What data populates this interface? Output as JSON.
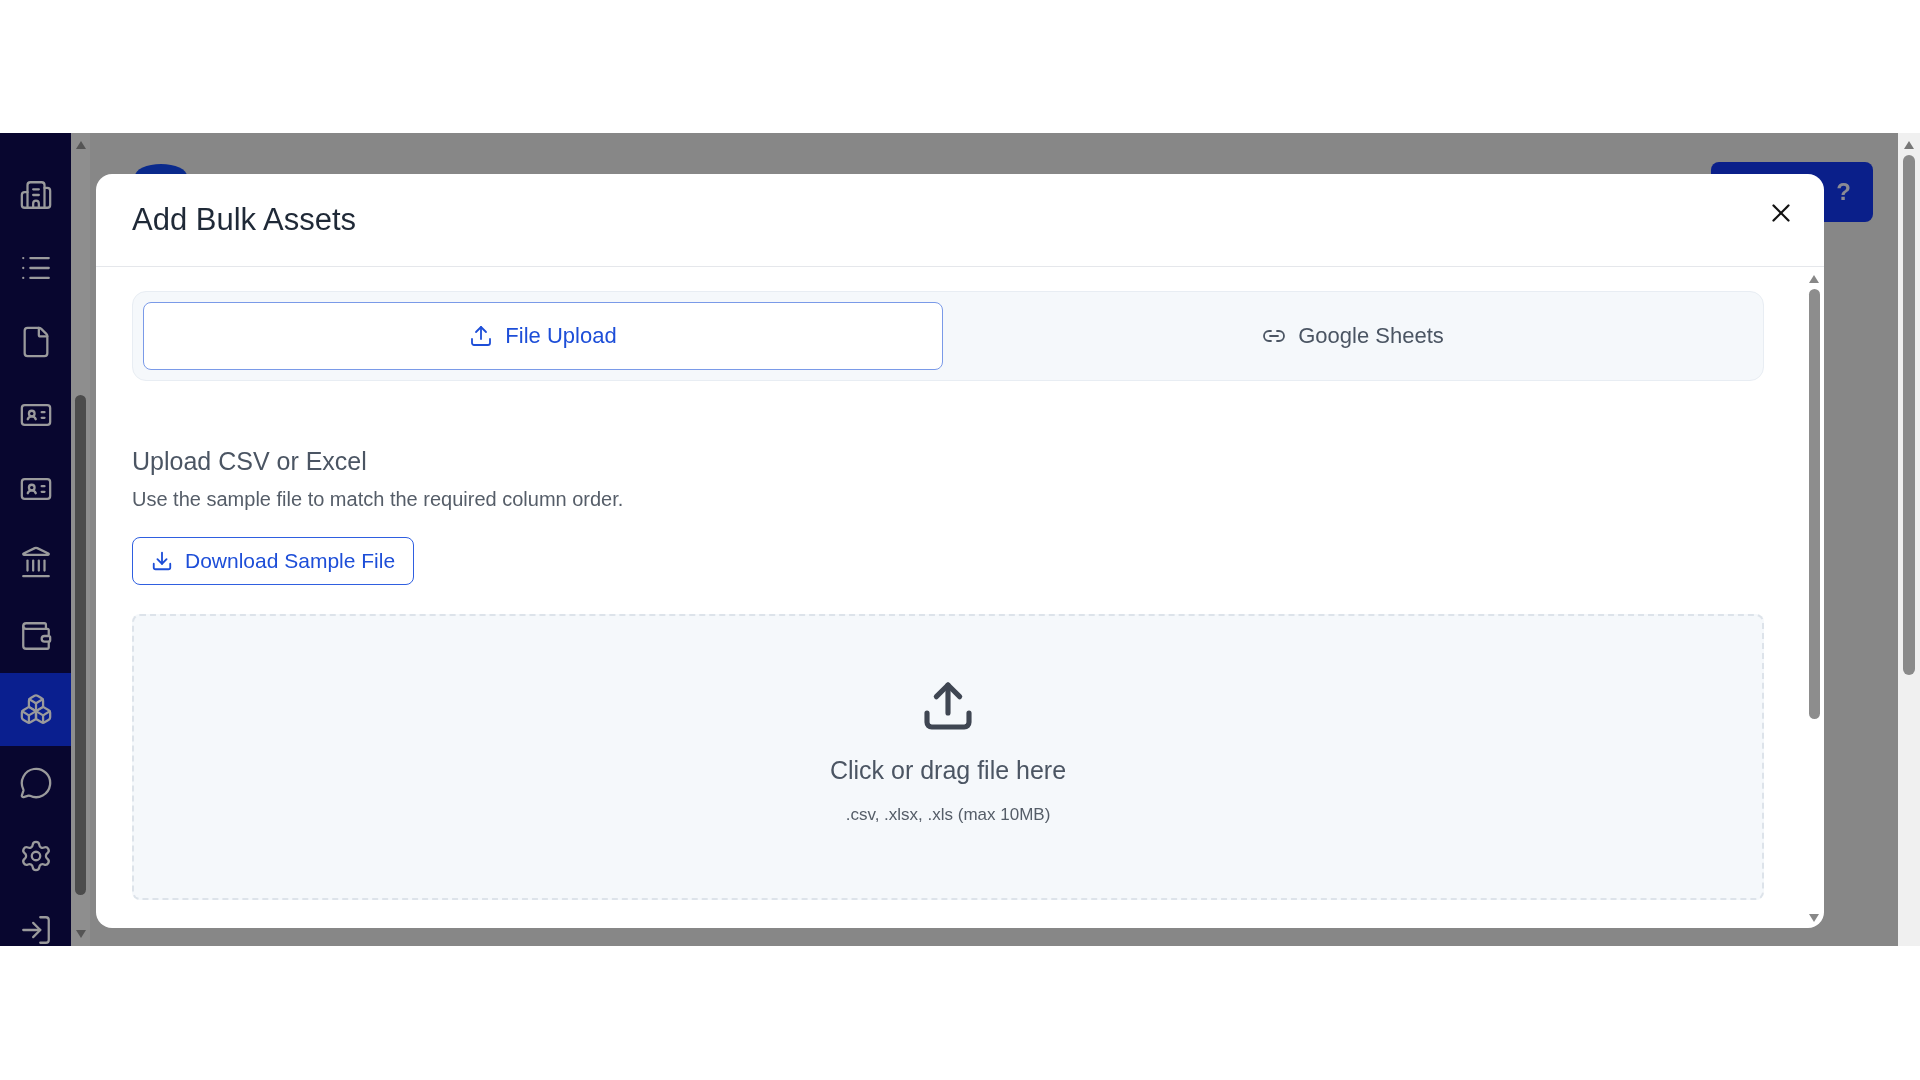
{
  "sidebar": {
    "items": [
      {
        "kind": "building",
        "selected": false
      },
      {
        "kind": "list",
        "selected": false
      },
      {
        "kind": "file",
        "selected": false
      },
      {
        "kind": "card",
        "selected": false
      },
      {
        "kind": "card",
        "selected": false
      },
      {
        "kind": "bank",
        "selected": false
      },
      {
        "kind": "wallet",
        "selected": false
      },
      {
        "kind": "boxes",
        "selected": true
      },
      {
        "kind": "chat",
        "selected": false
      },
      {
        "kind": "settings",
        "selected": false
      },
      {
        "kind": "logout",
        "selected": false
      }
    ]
  },
  "background": {
    "help_button": "?"
  },
  "modal": {
    "title": "Add Bulk Assets",
    "tabs": [
      {
        "label": "File Upload",
        "kind": "upload",
        "selected": true
      },
      {
        "label": "Google Sheets",
        "kind": "link",
        "selected": false
      }
    ],
    "section": {
      "title": "Upload CSV or Excel",
      "description": "Use the sample file to match the required column order."
    },
    "download_button": "Download Sample File",
    "dropzone": {
      "title": "Click or drag file here",
      "hint": ".csv, .xlsx, .xls (max 10MB)"
    }
  }
}
